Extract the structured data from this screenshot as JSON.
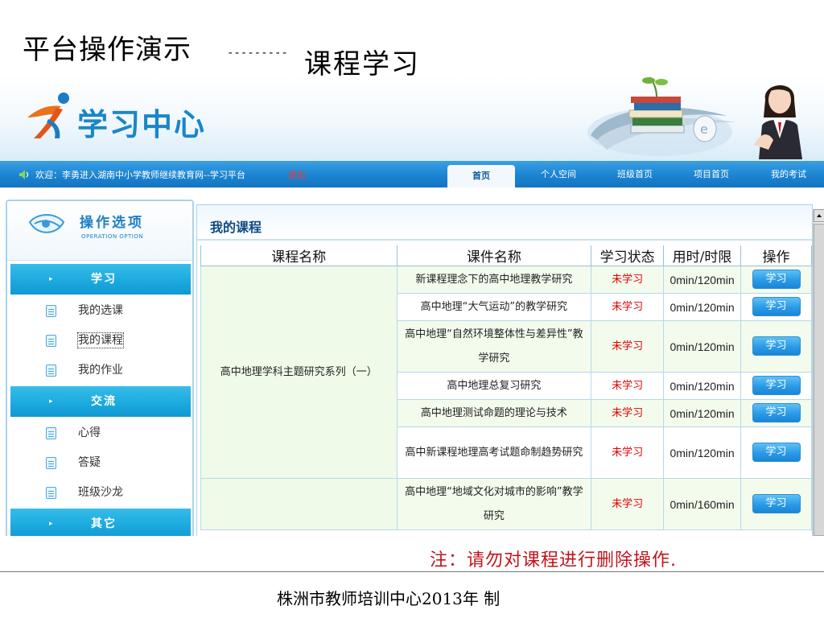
{
  "slide": {
    "title": "平台操作演示",
    "dashes": "---------",
    "subtitle": "课程学习",
    "note": "注：请勿对课程进行删除操作.",
    "footer": "株洲市教师培训中心2013年 制"
  },
  "banner": {
    "logo_text": "学习中心"
  },
  "navbar": {
    "welcome": "欢迎：李勇进入湖南中小学教师继续教育网--学习平台",
    "logout": "退出",
    "tabs": [
      "首页",
      "个人空间",
      "班级首页",
      "项目首页",
      "我的考试"
    ]
  },
  "sidebar": {
    "title": "操作选项",
    "title_en": "OPERATION OPTION",
    "arrow": "▸",
    "sections": [
      {
        "label": "学习",
        "items": [
          "我的选课",
          "我的课程",
          "我的作业"
        ]
      },
      {
        "label": "交流",
        "items": [
          "心得",
          "答疑",
          "班级沙龙"
        ]
      },
      {
        "label": "其它",
        "items": []
      }
    ]
  },
  "main": {
    "title": "我的课程",
    "columns": [
      "课程名称",
      "课件名称",
      "学习状态",
      "用时/时限",
      "操作"
    ],
    "course_1": "高中地理学科主题研究系列（一）",
    "course_2": "",
    "rows": [
      {
        "courseware": "新课程理念下的高中地理教学研究",
        "status": "未学习",
        "time": "0min/120min",
        "action": "学习"
      },
      {
        "courseware": "高中地理“大气运动”的教学研究",
        "status": "未学习",
        "time": "0min/120min",
        "action": "学习"
      },
      {
        "courseware": "高中地理“自然环境整体性与差异性”教学研究",
        "status": "未学习",
        "time": "0min/120min",
        "action": "学习"
      },
      {
        "courseware": "高中地理总复习研究",
        "status": "未学习",
        "time": "0min/120min",
        "action": "学习"
      },
      {
        "courseware": "高中地理测试命题的理论与技术",
        "status": "未学习",
        "time": "0min/120min",
        "action": "学习"
      },
      {
        "courseware": "高中新课程地理高考试题命制趋势研究",
        "status": "未学习",
        "time": "0min/120min",
        "action": "学习"
      },
      {
        "courseware": "高中地理“地域文化对城市的影响”教学研究",
        "status": "未学习",
        "time": "0min/160min",
        "action": "学习"
      }
    ]
  },
  "colors": {
    "accent_blue": "#1b84d1",
    "status_red": "#e00000",
    "note_red": "#c0141c",
    "course_cell_green": "#effbe8"
  }
}
